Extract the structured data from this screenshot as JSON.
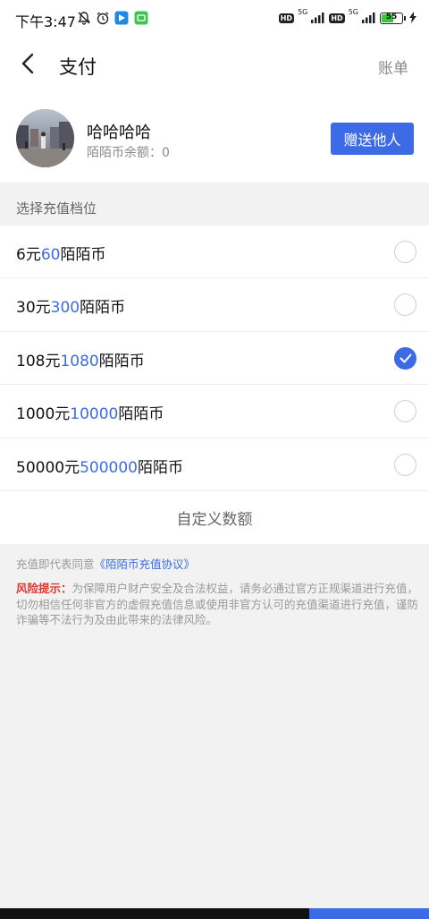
{
  "status_bar": {
    "time": "下午3:47",
    "hd1": "HD",
    "net1": "5G",
    "hd2": "HD",
    "net2": "5G",
    "battery": "55",
    "icons": [
      "mute-bell-icon",
      "alarm-icon",
      "app-notification-icon",
      "message-notification-icon",
      "signal-icon",
      "charging-icon"
    ]
  },
  "header": {
    "title": "支付",
    "bill": "账单",
    "back_icon": "chevron-left-icon"
  },
  "profile": {
    "name": "哈哈哈哈",
    "balance": "陌陌币余额：0",
    "gift_button": "赠送他人"
  },
  "section_label": "选择充值档位",
  "options": [
    {
      "price": "6元",
      "amount": "60",
      "unit": "陌陌币",
      "selected": false
    },
    {
      "price": "30元",
      "amount": "300",
      "unit": "陌陌币",
      "selected": false
    },
    {
      "price": "108元",
      "amount": "1080",
      "unit": "陌陌币",
      "selected": true
    },
    {
      "price": "1000元",
      "amount": "10000",
      "unit": "陌陌币",
      "selected": false
    },
    {
      "price": "50000元",
      "amount": "500000",
      "unit": "陌陌币",
      "selected": false
    }
  ],
  "custom_amount": "自定义数额",
  "agreement": {
    "prefix": "充值即代表同意",
    "link": "《陌陌币充值协议》"
  },
  "risk": {
    "title": "风险提示：",
    "text": "为保障用户财产安全及合法权益，请务必通过官方正规渠道进行充值，切勿相信任何非官方的虚假充值信息或使用非官方认可的充值渠道进行充值，谨防诈骗等不法行为及由此带来的法律风险。"
  },
  "colors": {
    "accent": "#3d6be5",
    "warning": "#e0362e",
    "background": "#f2f2f3"
  }
}
